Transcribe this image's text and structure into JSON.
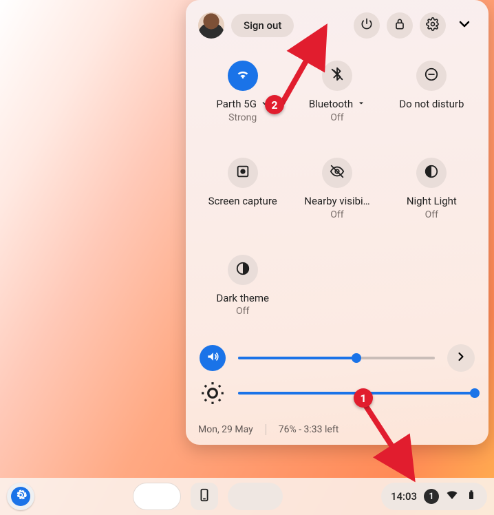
{
  "top": {
    "sign_out": "Sign out"
  },
  "tiles": {
    "wifi": {
      "label": "Parth 5G",
      "sub": "Strong"
    },
    "bluetooth": {
      "label": "Bluetooth",
      "sub": "Off"
    },
    "dnd": {
      "label": "Do not disturb"
    },
    "capture": {
      "label": "Screen capture"
    },
    "nearby": {
      "label": "Nearby visibi…",
      "sub": "Off"
    },
    "night": {
      "label": "Night Light",
      "sub": "Off"
    },
    "dark": {
      "label": "Dark theme",
      "sub": "Off"
    }
  },
  "sliders": {
    "volume_percent": 60,
    "brightness_percent": 100
  },
  "footer": {
    "date": "Mon, 29 May",
    "battery": "76% - 3:33 left"
  },
  "taskbar": {
    "time": "14:03",
    "notif_count": "1"
  },
  "annotations": {
    "step1": "1",
    "step2": "2"
  }
}
